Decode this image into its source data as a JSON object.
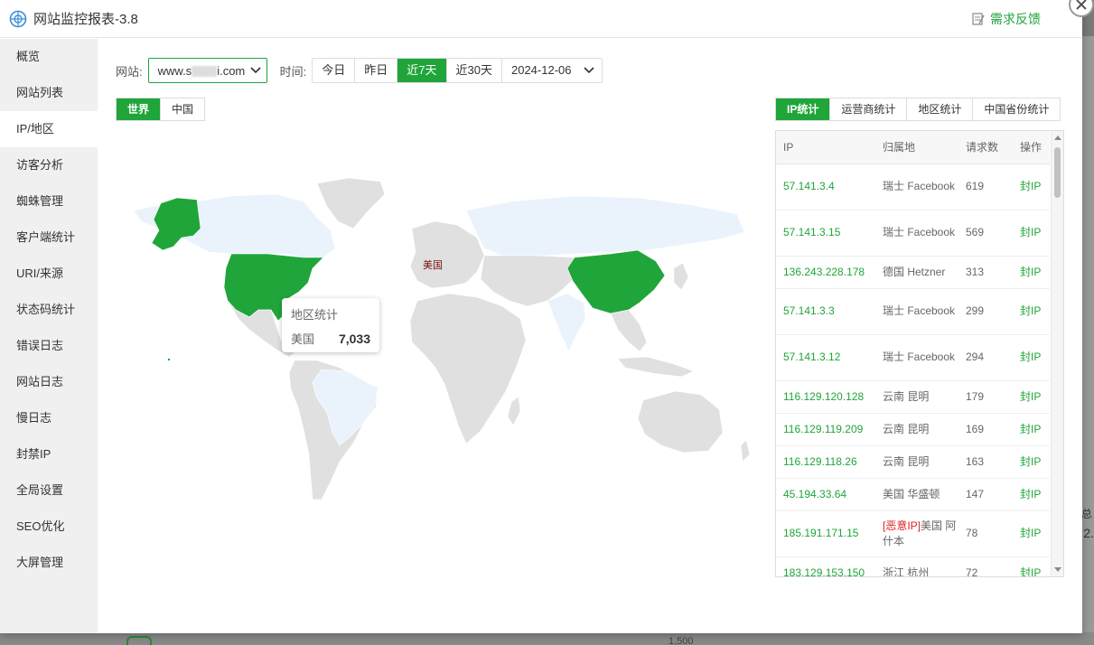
{
  "app": {
    "title": "网站监控报表-3.8",
    "feedback_label": "需求反馈"
  },
  "sidebar": {
    "items": [
      {
        "label": "概览"
      },
      {
        "label": "网站列表"
      },
      {
        "label": "IP/地区",
        "active": true
      },
      {
        "label": "访客分析"
      },
      {
        "label": "蜘蛛管理"
      },
      {
        "label": "客户端统计"
      },
      {
        "label": "URI/来源"
      },
      {
        "label": "状态码统计"
      },
      {
        "label": "错误日志"
      },
      {
        "label": "网站日志"
      },
      {
        "label": "慢日志"
      },
      {
        "label": "封禁IP"
      },
      {
        "label": "全局设置"
      },
      {
        "label": "SEO优化"
      },
      {
        "label": "大屏管理"
      }
    ]
  },
  "filters": {
    "site_label": "网站:",
    "site_value_prefix": "www.s",
    "site_value_suffix": "i.com",
    "time_label": "时间:",
    "time_buttons": [
      "今日",
      "昨日",
      "近7天",
      "近30天"
    ],
    "active_time": "近7天",
    "date_value": "2024-12-06"
  },
  "map_toggle": {
    "options": [
      "世界",
      "中国"
    ],
    "active": "世界"
  },
  "stat_tabs": {
    "options": [
      "IP统计",
      "运营商统计",
      "地区统计",
      "中国省份统计"
    ],
    "active": "IP统计"
  },
  "map": {
    "highlight_color": "#20a53a",
    "light_color": "#eaf3fc",
    "default_color": "#e0e0e0",
    "hover_label": "美国",
    "tooltip": {
      "title": "地区统计",
      "region": "美国",
      "value": "7,033"
    }
  },
  "table": {
    "headers": [
      "IP",
      "归属地",
      "请求数",
      "操作"
    ],
    "action_label": "封IP",
    "rows": [
      {
        "ip": "57.141.3.4",
        "loc": "瑞士 Facebook",
        "count": "619"
      },
      {
        "ip": "57.141.3.15",
        "loc": "瑞士 Facebook",
        "count": "569"
      },
      {
        "ip": "136.243.228.178",
        "loc": "德国 Hetzner",
        "count": "313"
      },
      {
        "ip": "57.141.3.3",
        "loc": "瑞士 Facebook",
        "count": "299"
      },
      {
        "ip": "57.141.3.12",
        "loc": "瑞士 Facebook",
        "count": "294"
      },
      {
        "ip": "116.129.120.128",
        "loc": "云南 昆明",
        "count": "179"
      },
      {
        "ip": "116.129.119.209",
        "loc": "云南 昆明",
        "count": "169"
      },
      {
        "ip": "116.129.118.26",
        "loc": "云南 昆明",
        "count": "163"
      },
      {
        "ip": "45.194.33.64",
        "loc": "美国 华盛顿",
        "count": "147"
      },
      {
        "ip": "185.191.171.15",
        "loc_tag": "[恶意IP]",
        "loc": "美国 阿什本",
        "count": "78"
      },
      {
        "ip": "183.129.153.150",
        "loc": "浙江 杭州",
        "count": "72"
      }
    ]
  },
  "backdrop": {
    "side_text_1": "总",
    "side_text_2": "2.",
    "bottom_text": "1,500"
  }
}
